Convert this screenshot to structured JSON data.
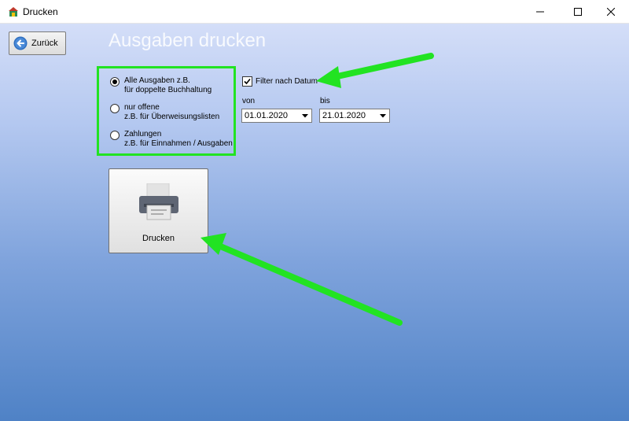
{
  "window": {
    "title": "Drucken",
    "icon": "house-icon"
  },
  "controls": {
    "minimize": "minimize-icon",
    "maximize": "maximize-icon",
    "close": "close-icon"
  },
  "back_button": {
    "label": "Zurück",
    "icon": "back-arrow-icon"
  },
  "heading": "Ausgaben drucken",
  "options": [
    {
      "line1": "Alle Ausgaben z.B.",
      "line2": "für doppelte Buchhaltung",
      "selected": true
    },
    {
      "line1": "nur offene",
      "line2": "z.B. für Überweisungslisten",
      "selected": false
    },
    {
      "line1": "Zahlungen",
      "line2": "z.B. für Einnahmen / Ausgaben",
      "selected": false
    }
  ],
  "filter": {
    "label": "Filter nach Datum",
    "checked": true
  },
  "date_from": {
    "label": "von",
    "value": "01.01.2020"
  },
  "date_to": {
    "label": "bis",
    "value": "21.01.2020"
  },
  "print_button": {
    "label": "Drucken",
    "icon": "printer-icon"
  },
  "annotation_color": "#22e322"
}
